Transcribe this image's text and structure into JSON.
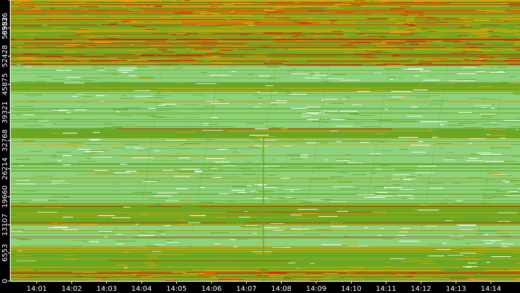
{
  "chart_data": {
    "type": "heatmap",
    "title": "",
    "xlabel": "",
    "ylabel": "",
    "grid": false,
    "legend": "none",
    "x_ticks": [
      "14:01",
      "14:02",
      "14:03",
      "14:04",
      "14:05",
      "14:06",
      "14:07",
      "14:08",
      "14:09",
      "14:10",
      "14:11",
      "14:12",
      "14:13",
      "14:14"
    ],
    "x_range": [
      "14:00:15",
      "14:14:50"
    ],
    "y_ticks": [
      0,
      6553,
      13107,
      19660,
      26214,
      32768,
      39321,
      45875,
      52428,
      58982,
      65536
    ],
    "y_range": [
      0,
      65536
    ],
    "colors": {
      "background": "#000000",
      "axis": "#ffffff",
      "light_green": "#8fd27e",
      "green": "#6aa823",
      "orange": "#f0a000",
      "red": "#e02000",
      "white": "#ffffff"
    },
    "bands": [
      {
        "from": 0,
        "to": 2600,
        "level": "high"
      },
      {
        "from": 2600,
        "to": 8000,
        "level": "medium"
      },
      {
        "from": 8000,
        "to": 13000,
        "level": "low"
      },
      {
        "from": 13000,
        "to": 18200,
        "level": "medium"
      },
      {
        "from": 18200,
        "to": 33400,
        "level": "low"
      },
      {
        "from": 33400,
        "to": 35600,
        "level": "medium"
      },
      {
        "from": 35600,
        "to": 44200,
        "level": "low"
      },
      {
        "from": 44200,
        "to": 46300,
        "level": "medium"
      },
      {
        "from": 46300,
        "to": 50300,
        "level": "low"
      },
      {
        "from": 50300,
        "to": 65536,
        "level": "high"
      }
    ]
  }
}
